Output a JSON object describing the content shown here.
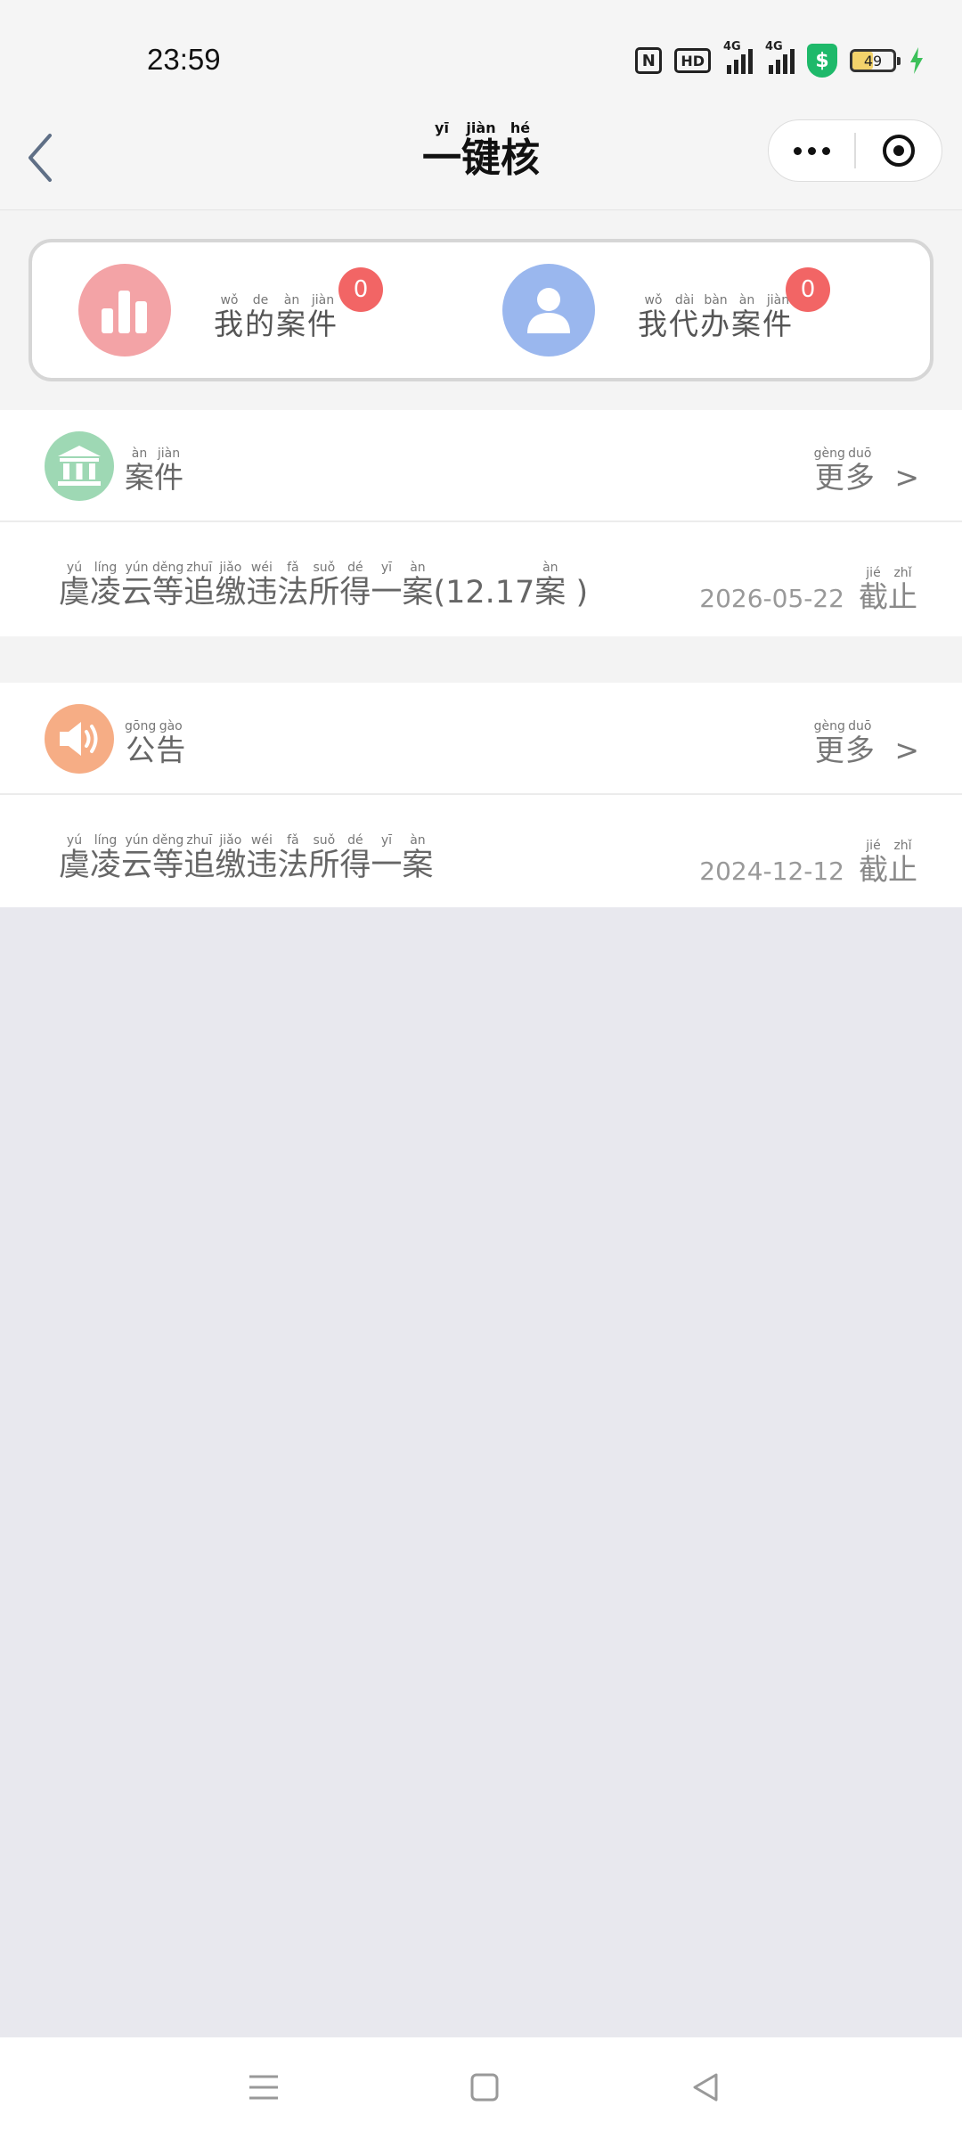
{
  "status_bar": {
    "time": "23:59",
    "battery_percent": "49",
    "battery_level": 0.49,
    "network_1": "4G",
    "network_2": "4G",
    "hd_label": "HD"
  },
  "nav": {
    "title": [
      {
        "char": "一",
        "pinyin": "yī"
      },
      {
        "char": "键",
        "pinyin": "jiàn"
      },
      {
        "char": "核",
        "pinyin": "hé"
      }
    ]
  },
  "summary": {
    "my_cases": {
      "label": [
        {
          "char": "我",
          "pinyin": "wǒ"
        },
        {
          "char": "的",
          "pinyin": "de"
        },
        {
          "char": "案",
          "pinyin": "àn"
        },
        {
          "char": "件",
          "pinyin": "jiàn"
        }
      ],
      "count": "0"
    },
    "proxy_cases": {
      "label": [
        {
          "char": "我",
          "pinyin": "wǒ"
        },
        {
          "char": "代",
          "pinyin": "dài"
        },
        {
          "char": "办",
          "pinyin": "bàn"
        },
        {
          "char": "案",
          "pinyin": "àn"
        },
        {
          "char": "件",
          "pinyin": "jiàn"
        }
      ],
      "count": "0"
    }
  },
  "cases_section": {
    "title": [
      {
        "char": "案",
        "pinyin": "àn"
      },
      {
        "char": "件",
        "pinyin": "jiàn"
      }
    ],
    "more": [
      {
        "char": "更",
        "pinyin": "gèng"
      },
      {
        "char": "多",
        "pinyin": "duō"
      }
    ],
    "more_arrow": ">",
    "item": {
      "text": [
        {
          "char": "虞",
          "pinyin": "yú"
        },
        {
          "char": "凌",
          "pinyin": "líng"
        },
        {
          "char": "云",
          "pinyin": "yún"
        },
        {
          "char": "等",
          "pinyin": "děng"
        },
        {
          "char": "追",
          "pinyin": "zhuī"
        },
        {
          "char": "缴",
          "pinyin": "jiǎo"
        },
        {
          "char": "违",
          "pinyin": "wéi"
        },
        {
          "char": "法",
          "pinyin": "fǎ"
        },
        {
          "char": "所",
          "pinyin": "suǒ"
        },
        {
          "char": "得",
          "pinyin": "dé"
        },
        {
          "char": "一",
          "pinyin": "yī"
        },
        {
          "char": "案",
          "pinyin": "àn"
        },
        {
          "char": "(12.17",
          "pinyin": ""
        },
        {
          "char": "案",
          "pinyin": "àn"
        },
        {
          "char": " )",
          "pinyin": ""
        }
      ],
      "date": "2026-05-22",
      "deadline": [
        {
          "char": "截",
          "pinyin": "jié"
        },
        {
          "char": "止",
          "pinyin": "zhǐ"
        }
      ]
    }
  },
  "notice_section": {
    "title": [
      {
        "char": "公",
        "pinyin": "gōng"
      },
      {
        "char": "告",
        "pinyin": "gào"
      }
    ],
    "more": [
      {
        "char": "更",
        "pinyin": "gèng"
      },
      {
        "char": "多",
        "pinyin": "duō"
      }
    ],
    "more_arrow": ">",
    "item": {
      "text": [
        {
          "char": "虞",
          "pinyin": "yú"
        },
        {
          "char": "凌",
          "pinyin": "líng"
        },
        {
          "char": "云",
          "pinyin": "yún"
        },
        {
          "char": "等",
          "pinyin": "děng"
        },
        {
          "char": "追",
          "pinyin": "zhuī"
        },
        {
          "char": "缴",
          "pinyin": "jiǎo"
        },
        {
          "char": "违",
          "pinyin": "wéi"
        },
        {
          "char": "法",
          "pinyin": "fǎ"
        },
        {
          "char": "所",
          "pinyin": "suǒ"
        },
        {
          "char": "得",
          "pinyin": "dé"
        },
        {
          "char": "一",
          "pinyin": "yī"
        },
        {
          "char": "案",
          "pinyin": "àn"
        }
      ],
      "date": "2024-12-12",
      "deadline": [
        {
          "char": "截",
          "pinyin": "jié"
        },
        {
          "char": "止",
          "pinyin": "zhǐ"
        }
      ]
    }
  },
  "icons": {
    "status": [
      "nfc-icon",
      "hd-icon",
      "signal-icon",
      "security-shield-icon",
      "battery-icon",
      "charging-icon"
    ],
    "nav": [
      "back-chevron-icon",
      "more-dots-icon",
      "target-icon"
    ],
    "my_cases": "bar-chart-icon",
    "proxy_cases": "user-icon",
    "cases": "bank-building-icon",
    "notice": "speaker-icon",
    "system_nav": [
      "menu-icon",
      "home-square-icon",
      "back-triangle-icon"
    ]
  },
  "colors": {
    "badge": "#f26565",
    "my_cases_icon": "#f3a3a6",
    "proxy_cases_icon": "#9ab7ee",
    "cases_icon": "#9ed8b4",
    "notice_icon": "#f6ad85",
    "shield": "#1eb96a",
    "battery_fill": "#f3d36b"
  }
}
